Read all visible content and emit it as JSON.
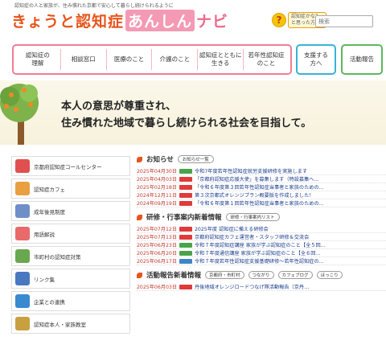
{
  "header": {
    "tagline": "認知症の人と家族が、住み慣れた京都で安心して暮らし続けられるように",
    "logo_part1": "きょうと認知症",
    "logo_part2": "あんしん",
    "logo_part3": "ナビ",
    "help_line1": "認知症かな？",
    "help_line2": "と思った方へ",
    "search_placeholder": "検索"
  },
  "nav": {
    "items": [
      {
        "line1": "認知症の",
        "line2": "理解"
      },
      {
        "line1": "相談窓口",
        "line2": ""
      },
      {
        "line1": "医療のこと",
        "line2": ""
      },
      {
        "line1": "介護のこと",
        "line2": ""
      },
      {
        "line1": "認知症とともに",
        "line2": "生きる"
      },
      {
        "line1": "若年性認知症",
        "line2": "のこと"
      }
    ],
    "support_line1": "支援する",
    "support_line2": "方へ",
    "activity": "活動報告"
  },
  "hero": {
    "line1": "本人の意思が尊重され、",
    "line2": "住み慣れた地域で暮らし続けられる社会を目指して。"
  },
  "sidebar": {
    "items": [
      {
        "label": "京都府認知症コールセンター",
        "color": "#e05050"
      },
      {
        "label": "認知症カフェ",
        "color": "#e8a040"
      },
      {
        "label": "成年後見制度",
        "color": "#6f8fc8"
      },
      {
        "label": "用語解説",
        "color": "#e86a6a"
      },
      {
        "label": "市町村の認知症対策",
        "color": "#6aa84f"
      },
      {
        "label": "リンク集",
        "color": "#4a78c0"
      },
      {
        "label": "企業との連携",
        "color": "#3a8ad0"
      },
      {
        "label": "認知症本人・家族教室",
        "color": "#c8a040"
      }
    ]
  },
  "news": {
    "title": "お知らせ",
    "list_button": "お知らせ一覧",
    "items": [
      {
        "date": "2025年04月30日",
        "badge": "green",
        "title": "令和7年度若年性認知症就労支援研修を実施します"
      },
      {
        "date": "2025年04月03日",
        "badge": "red",
        "title": "「京都府認知症応援大使」を募集します（特設募集へ…"
      },
      {
        "date": "2025年02月18日",
        "badge": "red",
        "title": "「令和６年度第３回若年性認知症当事者と家族のための…"
      },
      {
        "date": "2024年12月11日",
        "badge": "red",
        "title": "第３次京都式オレンジプラン概要版を作成しました！"
      },
      {
        "date": "2024年09月19日",
        "badge": "red",
        "title": "「令和６年度第１回若年性認知症当事者と家族のための…"
      }
    ]
  },
  "training": {
    "title": "研修・行事案内新着情報",
    "list_button": "研修・行事案内リスト",
    "items": [
      {
        "date": "2025年07月12日",
        "badge": "red",
        "title": "2025年度 認知症に備える研修会"
      },
      {
        "date": "2025年07月13日",
        "badge": "red",
        "title": "京都府認知症カフェ運営者・スタッフ研修＆交流会"
      },
      {
        "date": "2025年06月23日",
        "badge": "green",
        "title": "令和７年度認知症講座 家族が学ぶ認知症のこと【全５回…"
      },
      {
        "date": "2025年06月20日",
        "badge": "green",
        "title": "令和７年度通信講座 家族が学ぶ認知症のこと【全６回…"
      },
      {
        "date": "2025年06月17日",
        "badge": "blue",
        "title": "令和７年度若年性認知症支援基礎研修～若年性認知症の…"
      }
    ]
  },
  "activity": {
    "title": "活動報告新着情報",
    "buttons": [
      "京都府・市町村",
      "つながり",
      "カフェブログ",
      "ほっこり"
    ],
    "items": [
      {
        "date": "2025年06月03日",
        "badge": "red",
        "title": "丹後地域オレンジロードつなげ隊活動報告（京丹…"
      }
    ]
  },
  "colors": {
    "accent_orange": "#e8541c",
    "nav_pink": "#f07d96",
    "nav_blue": "#36b3d8",
    "nav_green": "#5cb85c"
  }
}
